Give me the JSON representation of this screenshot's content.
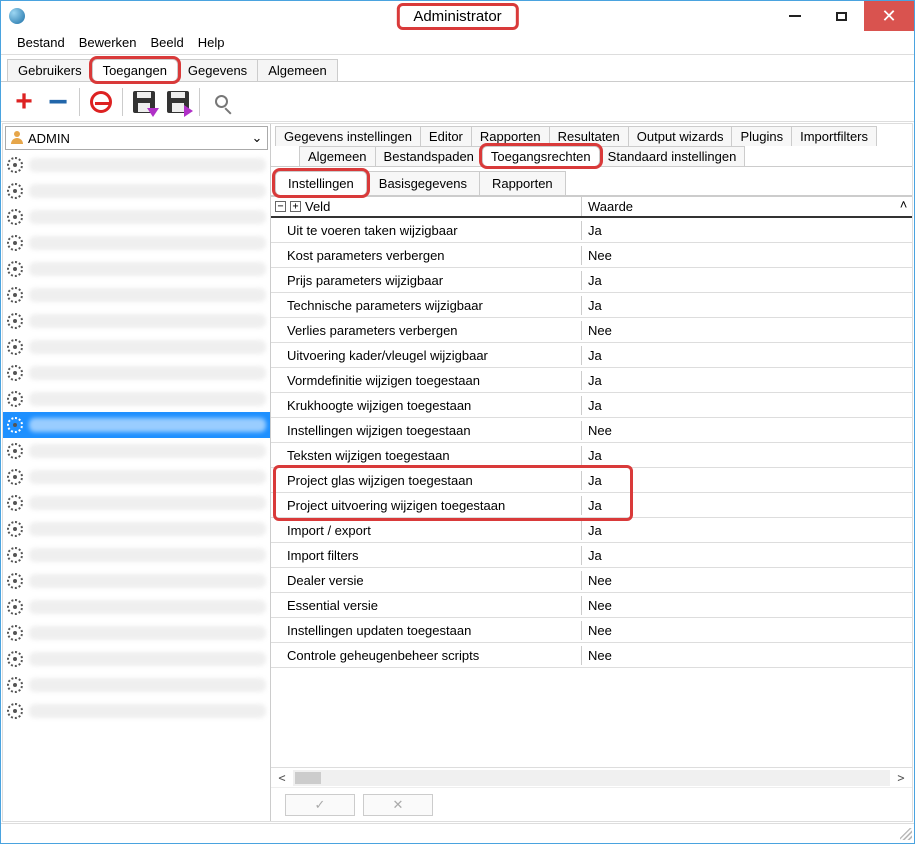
{
  "window": {
    "title": "Administrator"
  },
  "menu": [
    "Bestand",
    "Bewerken",
    "Beeld",
    "Help"
  ],
  "main_tabs": [
    "Gebruikers",
    "Toegangen",
    "Gegevens",
    "Algemeen"
  ],
  "main_tabs_active": 1,
  "sidebar": {
    "selected_user": "ADMIN",
    "item_count": 22,
    "selected_index": 10
  },
  "right_tabs_row1": [
    "Gegevens instellingen",
    "Editor",
    "Rapporten",
    "Resultaten",
    "Output wizards",
    "Plugins",
    "Importfilters"
  ],
  "right_tabs_row2": [
    "Algemeen",
    "Bestandspaden",
    "Toegangsrechten",
    "Standaard instellingen"
  ],
  "right_tabs_row2_active": 2,
  "right_tabs_row3": [
    "Instellingen",
    "Basisgegevens",
    "Rapporten"
  ],
  "right_tabs_row3_active": 0,
  "grid": {
    "columns": [
      "Veld",
      "Waarde"
    ],
    "rows": [
      {
        "veld": "Uit te voeren taken wijzigbaar",
        "waarde": "Ja"
      },
      {
        "veld": "Kost parameters verbergen",
        "waarde": "Nee"
      },
      {
        "veld": "Prijs parameters wijzigbaar",
        "waarde": "Ja"
      },
      {
        "veld": "Technische parameters wijzigbaar",
        "waarde": "Ja"
      },
      {
        "veld": "Verlies parameters verbergen",
        "waarde": "Nee"
      },
      {
        "veld": "Uitvoering kader/vleugel wijzigbaar",
        "waarde": "Ja"
      },
      {
        "veld": "Vormdefinitie wijzigen toegestaan",
        "waarde": "Ja"
      },
      {
        "veld": "Krukhoogte wijzigen toegestaan",
        "waarde": "Ja"
      },
      {
        "veld": "Instellingen wijzigen toegestaan",
        "waarde": "Nee"
      },
      {
        "veld": "Teksten wijzigen toegestaan",
        "waarde": "Ja"
      },
      {
        "veld": "Project glas wijzigen toegestaan",
        "waarde": "Ja"
      },
      {
        "veld": "Project uitvoering wijzigen toegestaan",
        "waarde": "Ja"
      },
      {
        "veld": "Import / export",
        "waarde": "Ja"
      },
      {
        "veld": "Import filters",
        "waarde": "Ja"
      },
      {
        "veld": "Dealer versie",
        "waarde": "Nee"
      },
      {
        "veld": "Essential versie",
        "waarde": "Nee"
      },
      {
        "veld": "Instellingen updaten toegestaan",
        "waarde": "Nee"
      },
      {
        "veld": "Controle geheugenbeheer scripts",
        "waarde": "Nee"
      }
    ],
    "highlight_rows": [
      10,
      11
    ]
  }
}
